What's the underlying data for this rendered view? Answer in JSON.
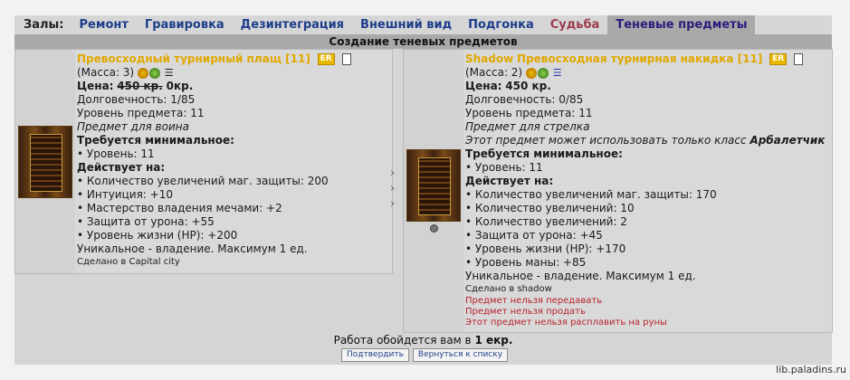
{
  "nav": {
    "label": "Залы:",
    "items": [
      {
        "label": "Ремонт",
        "state": "normal"
      },
      {
        "label": "Гравировка",
        "state": "normal"
      },
      {
        "label": "Дезинтеграция",
        "state": "normal"
      },
      {
        "label": "Внешний вид",
        "state": "normal"
      },
      {
        "label": "Подгонка",
        "state": "normal"
      },
      {
        "label": "Судьба",
        "state": "alt"
      },
      {
        "label": "Теневые предметы",
        "state": "active"
      }
    ]
  },
  "title": "Создание теневых предметов",
  "left_item": {
    "name": "Превосходный турнирный плащ [11]",
    "badge": "ER",
    "mass": "(Масса: 3)",
    "price_label": "Цена:",
    "price_old": "450 кр.",
    "price_new": "0кр.",
    "durability": "Долговечность: 1/85",
    "level": "Уровень предмета: 11",
    "class_note": "Предмет для воина",
    "req_title": "Требуется минимальное:",
    "req_level": "• Уровень: 11",
    "acts_title": "Действует на:",
    "effects": [
      "• Количество увеличений маг. защиты: 200",
      "• Интуиция: +10",
      "• Мастерство владения мечами: +2",
      "• Защита от урона: +55",
      "• Уровень жизни (HP): +200"
    ],
    "unique": "Уникальное - владение. Максимум 1 ед.",
    "made_in": "Сделано в Capital city"
  },
  "right_item": {
    "name_prefix": "Shadow",
    "name": "Превосходная турнирная накидка [11]",
    "badge": "ER",
    "mass": "(Масса: 2)",
    "price_label": "Цена:",
    "price": "450 кр.",
    "durability": "Долговечность: 0/85",
    "level": "Уровень предмета: 11",
    "class_note": "Предмет для стрелка",
    "class_only": "Этот предмет может использовать только класс",
    "class_name": "Арбалетчик",
    "req_title": "Требуется минимальное:",
    "req_level": "• Уровень: 11",
    "acts_title": "Действует на:",
    "effects": [
      "• Количество увеличений маг. защиты: 170",
      "• Количество увеличений: 10",
      "• Количество увеличений: 2",
      "• Защита от урона: +45",
      "• Уровень жизни (HP): +170",
      "• Уровень маны: +85"
    ],
    "unique": "Уникальное - владение. Максимум 1 ед.",
    "made_in": "Сделано в shadow",
    "restrictions": [
      "Предмет нельзя передавать",
      "Предмет нельзя продать",
      "Этот предмет нельзя расплавить на руны"
    ]
  },
  "footer": {
    "cost_text": "Работа обойдется вам в",
    "cost_value": "1 екр.",
    "confirm": "Подтвердить",
    "back": "Вернуться к списку"
  },
  "site": "lib.paladins.ru"
}
